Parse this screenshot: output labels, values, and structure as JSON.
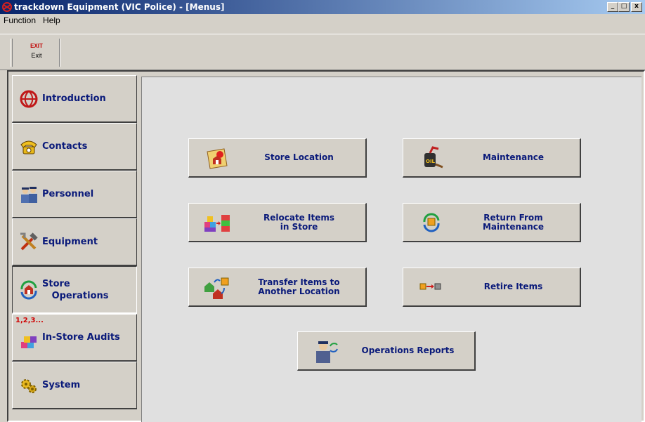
{
  "window": {
    "title": "trackdown Equipment (VIC Police) - [Menus]",
    "minimize": "_",
    "maximize": "□",
    "close": "x"
  },
  "menu": {
    "items": [
      "Function",
      "Help"
    ]
  },
  "toolbar": {
    "exit_icon_text": "EXIT",
    "exit_label": "Exit"
  },
  "nav": {
    "items": [
      {
        "label": "Introduction",
        "icon": "globe-icon"
      },
      {
        "label": "Contacts",
        "icon": "telephone-icon"
      },
      {
        "label": "Personnel",
        "icon": "police-officers-icon"
      },
      {
        "label": "Equipment",
        "icon": "tools-icon"
      },
      {
        "label": "Store\n   Operations",
        "icon": "store-operations-icon",
        "active": true
      },
      {
        "label": "In-Store Audits",
        "icon": "audit-icon",
        "badge": "1,2,3..."
      },
      {
        "label": "System",
        "icon": "gears-icon"
      }
    ]
  },
  "actions": {
    "store_location": "Store Location",
    "maintenance": "Maintenance",
    "relocate_items": "Relocate Items\nin Store",
    "return_from_maintenance": "Return From\nMaintenance",
    "transfer_items": "Transfer Items to\nAnother Location",
    "retire_items": "Retire Items",
    "operations_reports": "Operations Reports"
  },
  "colors": {
    "label_blue": "#0a1a7a",
    "panel_bg": "#e0e0e0",
    "chrome": "#d4d0c8",
    "title_start": "#08246b",
    "title_end": "#a6caf0"
  }
}
